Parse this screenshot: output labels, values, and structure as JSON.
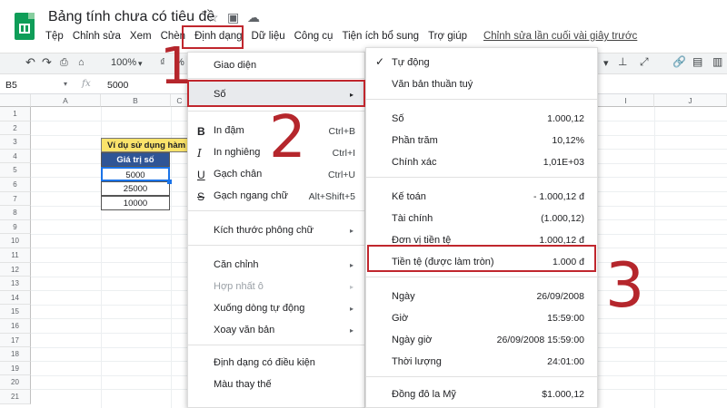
{
  "title_bar": {
    "doc_title": "Bảng tính chưa có tiêu đề",
    "icons": [
      "star-icon",
      "move-to-folder-icon",
      "cloud-status-icon"
    ]
  },
  "menubar": {
    "items": [
      "Tệp",
      "Chỉnh sửa",
      "Xem",
      "Chèn",
      "Định dạng",
      "Dữ liệu",
      "Công cụ",
      "Tiện ích bổ sung",
      "Trợ giúp"
    ],
    "last_edit": "Chỉnh sửa lần cuối vài giây trước"
  },
  "toolbar": {
    "zoom": "100%",
    "zoom_arrow": "▾",
    "percent": "%"
  },
  "formula_bar": {
    "name_box": "B5",
    "fx": "fx",
    "value": "5000"
  },
  "grid": {
    "columns": [
      "A",
      "B",
      "C",
      "I",
      "J"
    ],
    "rows": [
      "1",
      "2",
      "3",
      "4",
      "5",
      "6",
      "7",
      "8",
      "9",
      "10",
      "11",
      "12",
      "13",
      "14",
      "15",
      "16",
      "17",
      "18",
      "19",
      "20",
      "21"
    ],
    "table_title": "Ví dụ sử dụng hàm",
    "table_header": "Giá trị số",
    "values": [
      "5000",
      "25000",
      "10000"
    ]
  },
  "format_menu": {
    "theme": "Giao diện",
    "number": "Số",
    "bold": "In đậm",
    "bold_key": "Ctrl+B",
    "italic": "In nghiêng",
    "italic_key": "Ctrl+I",
    "underline": "Gạch chân",
    "underline_key": "Ctrl+U",
    "strikethrough": "Gạch ngang chữ",
    "strikethrough_key": "Alt+Shift+5",
    "font_size": "Kích thước phông chữ",
    "align": "Căn chỉnh",
    "merge": "Hợp nhất ô",
    "wrap": "Xuống dòng tự động",
    "rotate": "Xoay văn bản",
    "conditional": "Định dạng có điều kiện",
    "alternating": "Màu thay thế",
    "icon_bold": "B",
    "icon_italic": "I",
    "icon_underline": "U",
    "icon_strike": "S",
    "submenu_arrow": "▸"
  },
  "number_submenu": {
    "items": [
      {
        "label": "Tự động",
        "value": ""
      },
      {
        "label": "Văn bản thuần tuý",
        "value": ""
      },
      {
        "label": "Số",
        "value": "1.000,12"
      },
      {
        "label": "Phần trăm",
        "value": "10,12%"
      },
      {
        "label": "Chính xác",
        "value": "1,01E+03"
      },
      {
        "label": "Kế toán",
        "value": "- 1.000,12 đ"
      },
      {
        "label": "Tài chính",
        "value": "(1.000,12)"
      },
      {
        "label": "Đơn vị tiền tệ",
        "value": "1.000,12 đ"
      },
      {
        "label": "Tiền tệ (được làm tròn)",
        "value": "1.000 đ"
      },
      {
        "label": "Ngày",
        "value": "26/09/2008"
      },
      {
        "label": "Giờ",
        "value": "15:59:00"
      },
      {
        "label": "Ngày giờ",
        "value": "26/09/2008 15:59:00"
      },
      {
        "label": "Thời lượng",
        "value": "24:01:00"
      },
      {
        "label": "Đồng đô la Mỹ",
        "value": "$1.000,12"
      }
    ],
    "check": "✓"
  },
  "annotations": {
    "step1": "1",
    "step2": "2",
    "step3": "3",
    "color": "#c0262d"
  }
}
